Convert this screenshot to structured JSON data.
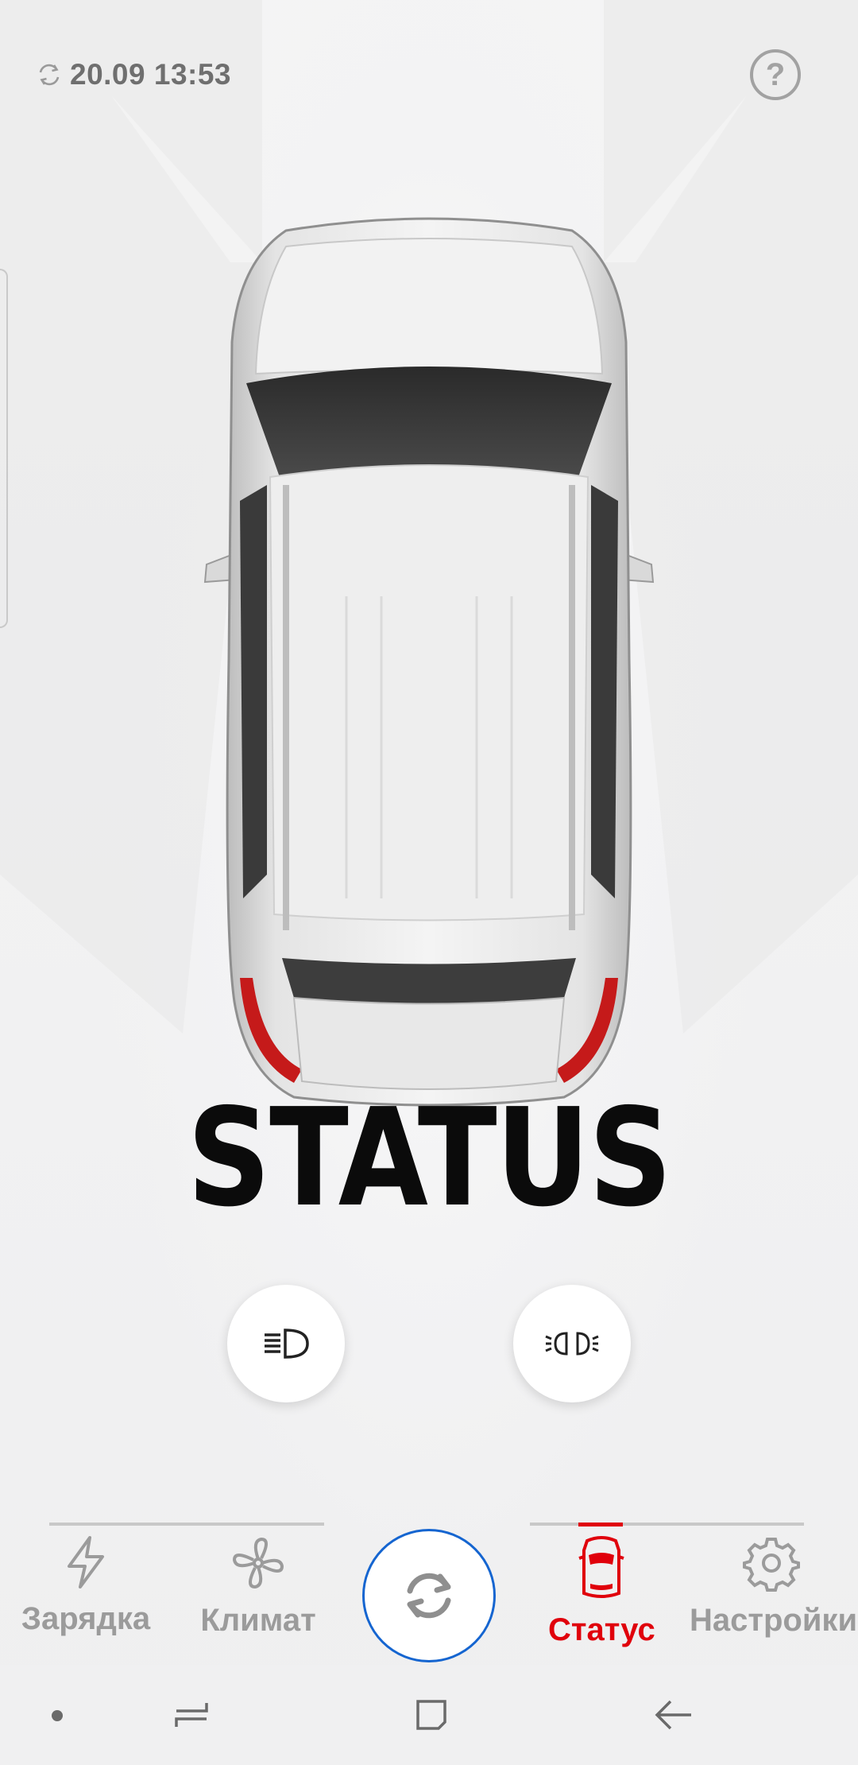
{
  "header": {
    "sync_time": "20.09 13:53",
    "help_label": "?"
  },
  "hero": {
    "title": "STATUS"
  },
  "lights": {
    "low_beam_icon": "low-beam-headlight-icon",
    "side_lights_icon": "side-lights-icon"
  },
  "tabs": [
    {
      "label": "Зарядка",
      "icon": "lightning-icon",
      "active": false
    },
    {
      "label": "Климат",
      "icon": "fan-icon",
      "active": false
    },
    {
      "label": "Статус",
      "icon": "car-status-icon",
      "active": true
    },
    {
      "label": "Настройки",
      "icon": "gear-icon",
      "active": false
    }
  ],
  "refresh_icon": "refresh-icon",
  "colors": {
    "accent_red": "#e0000b",
    "refresh_border_blue": "#1565d0",
    "inactive_gray": "#9b9b9b"
  }
}
